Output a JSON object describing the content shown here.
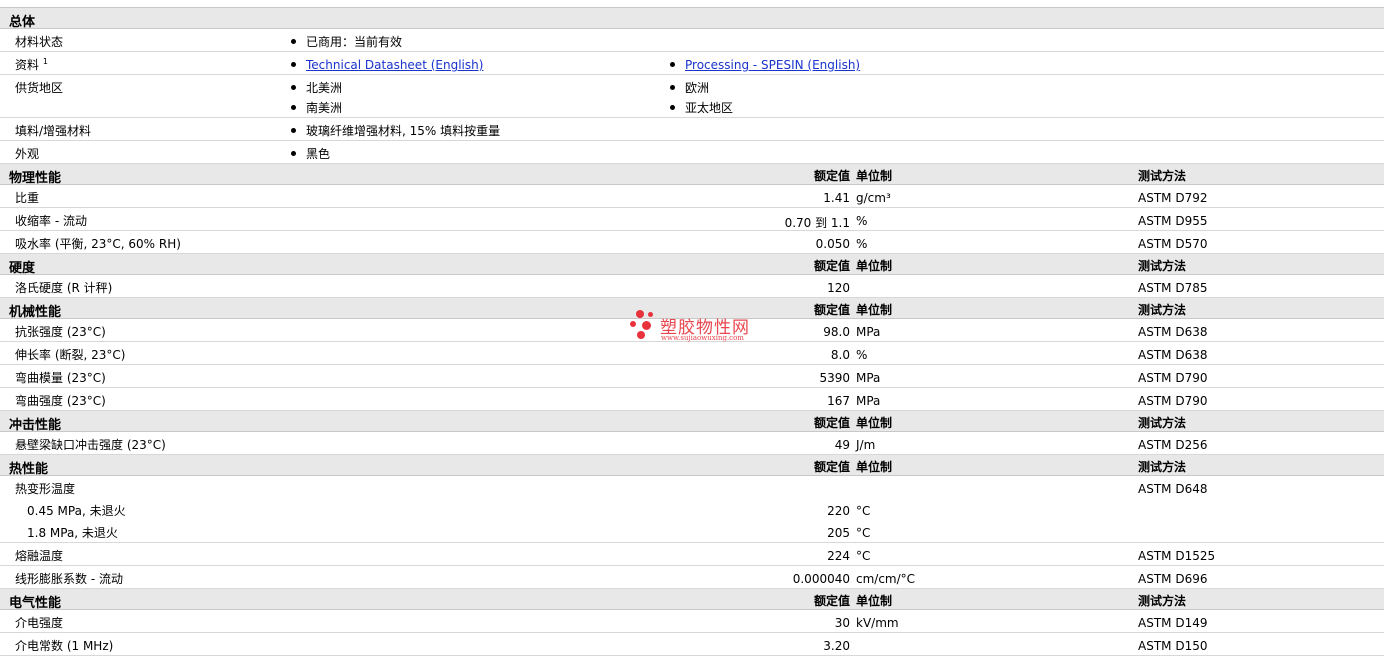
{
  "general": {
    "title": "总体",
    "status": {
      "label": "材料状态",
      "value": "已商用：当前有效"
    },
    "docs": {
      "label": "资料",
      "sup": "1",
      "link1": "Technical Datasheet (English)",
      "link2": "Processing - SPESIN (English)"
    },
    "regions": {
      "label": "供货地区",
      "items": [
        "北美洲",
        "欧洲",
        "南美洲",
        "亚太地区"
      ]
    },
    "filler": {
      "label": "填料/增强材料",
      "value": "玻璃纤维增强材料, 15% 填料按重量"
    },
    "appearance": {
      "label": "外观",
      "value": "黑色"
    }
  },
  "headers": {
    "value": "额定值",
    "unit": "单位制",
    "method": "测试方法"
  },
  "sections": [
    {
      "title": "物理性能",
      "rows": [
        {
          "label": "比重",
          "value": "1.41",
          "unit": "g/cm³",
          "method": "ASTM D792"
        },
        {
          "label": "收缩率 - 流动",
          "value": "0.70 到 1.1",
          "unit": "%",
          "method": "ASTM D955"
        },
        {
          "label": "吸水率 (平衡, 23°C, 60% RH)",
          "value": "0.050",
          "unit": "%",
          "method": "ASTM D570"
        }
      ]
    },
    {
      "title": "硬度",
      "rows": [
        {
          "label": "洛氏硬度 (R 计秤)",
          "value": "120",
          "unit": "",
          "method": "ASTM D785"
        }
      ]
    },
    {
      "title": "机械性能",
      "rows": [
        {
          "label": "抗张强度 (23°C)",
          "value": "98.0",
          "unit": "MPa",
          "method": "ASTM D638"
        },
        {
          "label": "伸长率 (断裂, 23°C)",
          "value": "8.0",
          "unit": "%",
          "method": "ASTM D638"
        },
        {
          "label": "弯曲模量 (23°C)",
          "value": "5390",
          "unit": "MPa",
          "method": "ASTM D790"
        },
        {
          "label": "弯曲强度 (23°C)",
          "value": "167",
          "unit": "MPa",
          "method": "ASTM D790"
        }
      ]
    },
    {
      "title": "冲击性能",
      "rows": [
        {
          "label": "悬壁梁缺口冲击强度 (23°C)",
          "value": "49",
          "unit": "J/m",
          "method": "ASTM D256"
        }
      ]
    },
    {
      "title": "热性能",
      "rows": [
        {
          "label": "热变形温度",
          "value": "",
          "unit": "",
          "method": "ASTM D648",
          "noline": true
        },
        {
          "label": "0.45 MPa, 未退火",
          "value": "220",
          "unit": "°C",
          "method": "",
          "sub": true,
          "noline": true
        },
        {
          "label": "1.8 MPa, 未退火",
          "value": "205",
          "unit": "°C",
          "method": "",
          "sub": true
        },
        {
          "label": "熔融温度",
          "value": "224",
          "unit": "°C",
          "method": "ASTM D1525"
        },
        {
          "label": "线形膨胀系数 - 流动",
          "value": "0.000040",
          "unit": "cm/cm/°C",
          "method": "ASTM D696"
        }
      ]
    },
    {
      "title": "电气性能",
      "rows": [
        {
          "label": "介电强度",
          "value": "30",
          "unit": "kV/mm",
          "method": "ASTM D149"
        },
        {
          "label": "介电常数 (1 MHz)",
          "value": "3.20",
          "unit": "",
          "method": "ASTM D150"
        }
      ]
    }
  ],
  "watermark": {
    "cn": "塑胶物性网",
    "en": "www.sujiaowuxing.com",
    "color": "#e8323c"
  }
}
